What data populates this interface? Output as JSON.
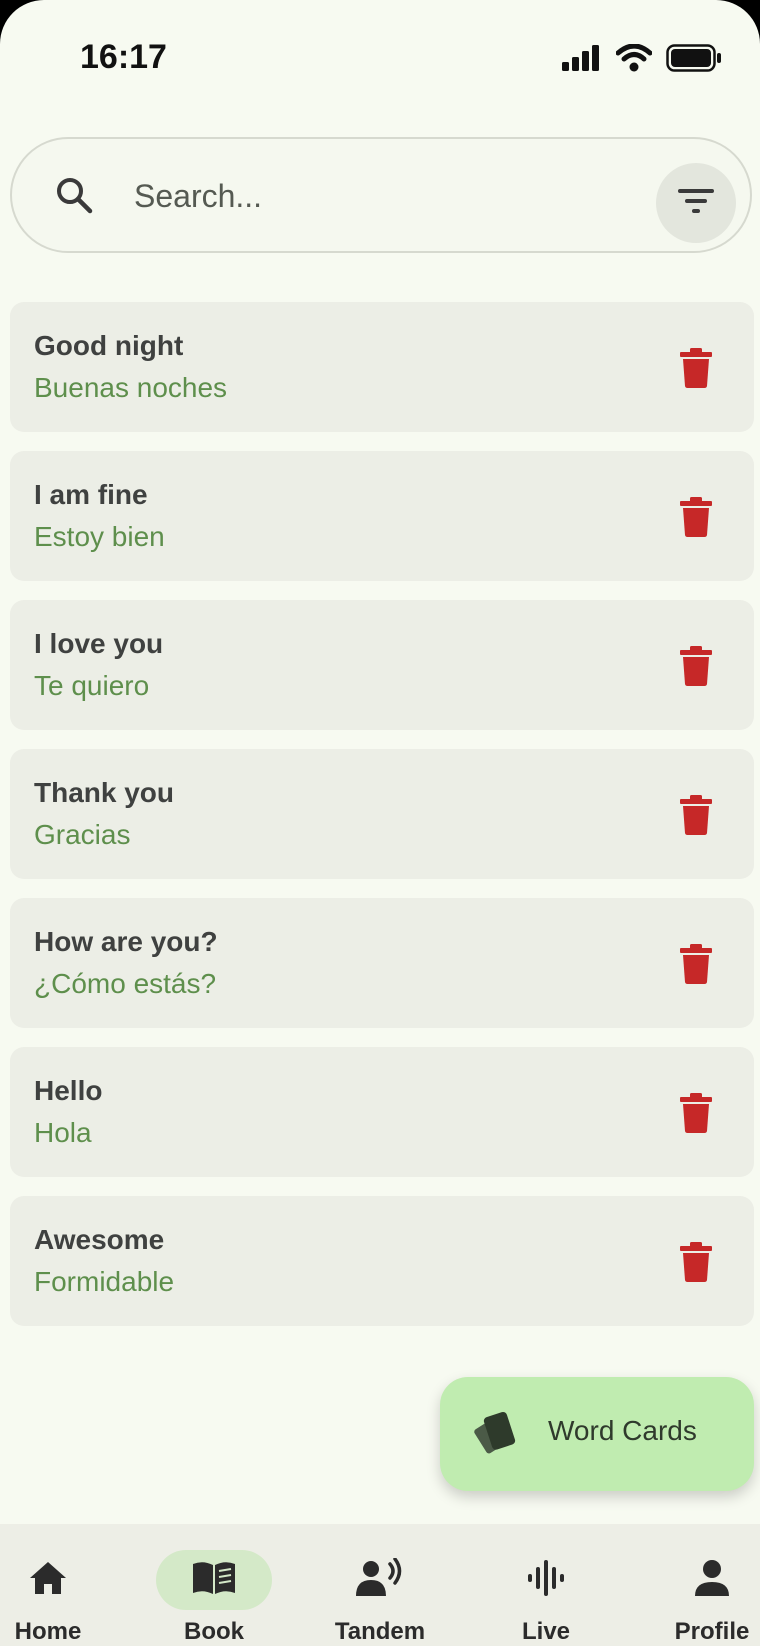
{
  "status_bar": {
    "time": "16:17",
    "icons": [
      "cellular-signal-icon",
      "wifi-icon",
      "battery-icon"
    ]
  },
  "search": {
    "placeholder": "Search...",
    "value": "",
    "search_icon": "search-icon",
    "filter_icon": "filter-icon"
  },
  "words": [
    {
      "term": "Good night",
      "translation": "Buenas noches"
    },
    {
      "term": "I am fine",
      "translation": "Estoy bien"
    },
    {
      "term": "I love you",
      "translation": "Te quiero"
    },
    {
      "term": "Thank you",
      "translation": "Gracias"
    },
    {
      "term": "How are you?",
      "translation": "¿Cómo estás?"
    },
    {
      "term": "Hello",
      "translation": "Hola"
    },
    {
      "term": "Awesome",
      "translation": "Formidable"
    }
  ],
  "fab": {
    "label": "Word Cards",
    "icon": "cards-icon"
  },
  "bottom_nav": {
    "items": [
      {
        "label": "Home",
        "icon": "home-icon",
        "active": false
      },
      {
        "label": "Book",
        "icon": "book-icon",
        "active": true
      },
      {
        "label": "Tandem",
        "icon": "tandem-speaker-icon",
        "active": false
      },
      {
        "label": "Live",
        "icon": "audio-wave-icon",
        "active": false
      },
      {
        "label": "Profile",
        "icon": "person-icon",
        "active": false
      }
    ]
  },
  "colors": {
    "background": "#f7faf1",
    "card": "#eceee6",
    "translation_text": "#5e8f4c",
    "delete_red": "#c62828",
    "fab": "#c0ecb0",
    "nav_active_pill": "#d4e9c8"
  }
}
